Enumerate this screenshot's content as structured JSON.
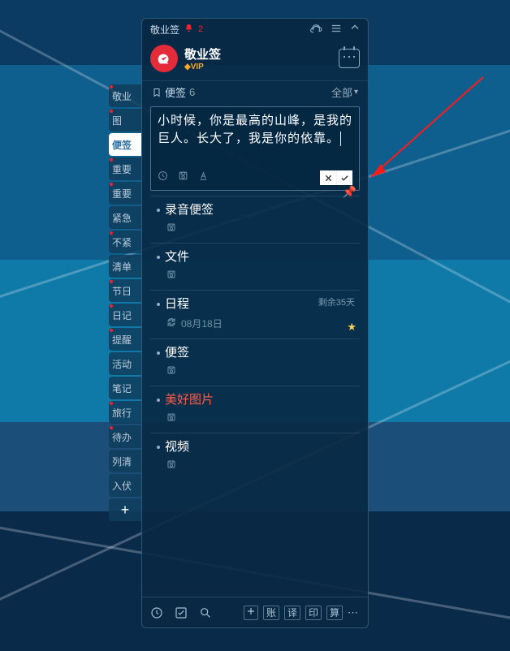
{
  "titlebar": {
    "app_name": "敬业签",
    "badge_count": "2"
  },
  "brand": {
    "name": "敬业签",
    "vip": "VIP"
  },
  "list_header": {
    "icon_label": "便签",
    "count": "6",
    "filter": "全部"
  },
  "editor": {
    "text": "小时候，你是最高的山峰，是我的巨人。长大了，我是你的依靠。"
  },
  "notes": [
    {
      "title": "录音便签",
      "pinned": true
    },
    {
      "title": "文件"
    },
    {
      "title": "日程",
      "sub_date": "08月18日",
      "remaining": "剩余35天",
      "starred": true
    },
    {
      "title": "便签"
    },
    {
      "title": "美好图片",
      "red": true
    },
    {
      "title": "视频"
    }
  ],
  "side_tabs": [
    "敬业",
    "图",
    "便签",
    "重要",
    "重要",
    "紧急",
    "不紧",
    "清单",
    "节日",
    "日记",
    "提醒",
    "活动",
    "笔记",
    "旅行",
    "待办",
    "列清",
    "入伏"
  ],
  "side_tab_red_dots": [
    0,
    1,
    3,
    4,
    6,
    8,
    9,
    10,
    13,
    14
  ],
  "bottombar": {
    "btn1": "账",
    "btn2": "译",
    "btn3": "印",
    "btn4": "算"
  }
}
